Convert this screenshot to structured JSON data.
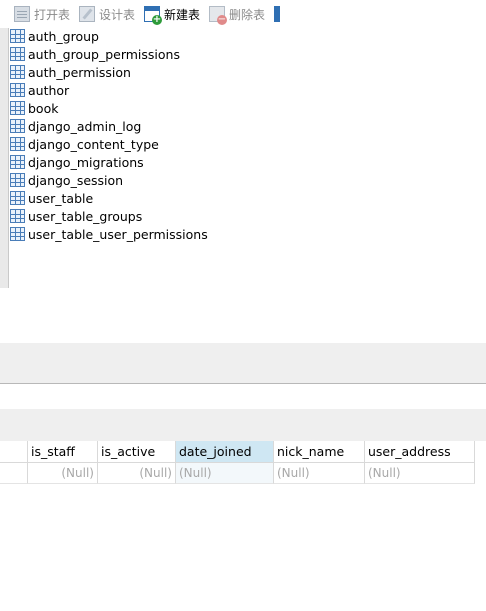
{
  "toolbar": {
    "open_table": "打开表",
    "design_table": "设计表",
    "new_table": "新建表",
    "delete_table": "删除表"
  },
  "tables": [
    "auth_group",
    "auth_group_permissions",
    "auth_permission",
    "author",
    "book",
    "django_admin_log",
    "django_content_type",
    "django_migrations",
    "django_session",
    "user_table",
    "user_table_groups",
    "user_table_user_permissions"
  ],
  "grid": {
    "columns": [
      "is_staff",
      "is_active",
      "date_joined",
      "nick_name",
      "user_address"
    ],
    "selected_column": "date_joined",
    "row": [
      "(Null)",
      "(Null)",
      "(Null)",
      "(Null)",
      "(Null)"
    ]
  },
  "colors": {
    "accent": "#2f6fb3",
    "selected_header": "#cfe7f3",
    "null_text": "#a8a8a8"
  }
}
